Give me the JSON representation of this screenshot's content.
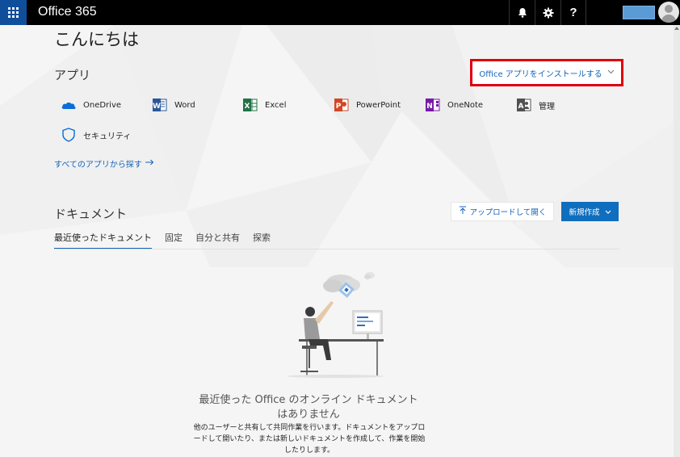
{
  "topbar": {
    "app_title": "Office 365",
    "icons": [
      "waffle-icon",
      "bell-icon",
      "gear-icon",
      "help-icon",
      "avatar"
    ],
    "help_label": "?"
  },
  "main": {
    "greeting": "こんにちは",
    "apps": {
      "heading": "アプリ",
      "install_label": "Office アプリをインストールする",
      "items": [
        {
          "label": "OneDrive",
          "icon": "onedrive-icon",
          "color": "#0a6dd7"
        },
        {
          "label": "Word",
          "icon": "word-icon",
          "color": "#2b579a"
        },
        {
          "label": "Excel",
          "icon": "excel-icon",
          "color": "#217346"
        },
        {
          "label": "PowerPoint",
          "icon": "powerpoint-icon",
          "color": "#d24726"
        },
        {
          "label": "OneNote",
          "icon": "onenote-icon",
          "color": "#7719aa"
        },
        {
          "label": "管理",
          "icon": "admin-icon",
          "color": "#505050"
        },
        {
          "label": "セキュリティ",
          "icon": "security-icon",
          "color": "#0a6dd7"
        }
      ],
      "all_apps_link": "すべてのアプリから探す"
    },
    "documents": {
      "heading": "ドキュメント",
      "upload_label": "アップロードして開く",
      "new_label": "新規作成",
      "tabs": [
        "最近使ったドキュメント",
        "固定",
        "自分と共有",
        "探索"
      ],
      "empty_title": "最近使った Office のオンライン ドキュメントはありません",
      "empty_subtitle": "他のユーザーと共有して共同作業を行います。ドキュメントをアップロードして開いたり、または新しいドキュメントを作成して、作業を開始したりします。"
    }
  },
  "colors": {
    "accent": "#1463b9",
    "topbar": "#000000",
    "waffle": "#0f4e9b",
    "highlight_border": "#e0000f",
    "primary_button": "#106ebe"
  }
}
